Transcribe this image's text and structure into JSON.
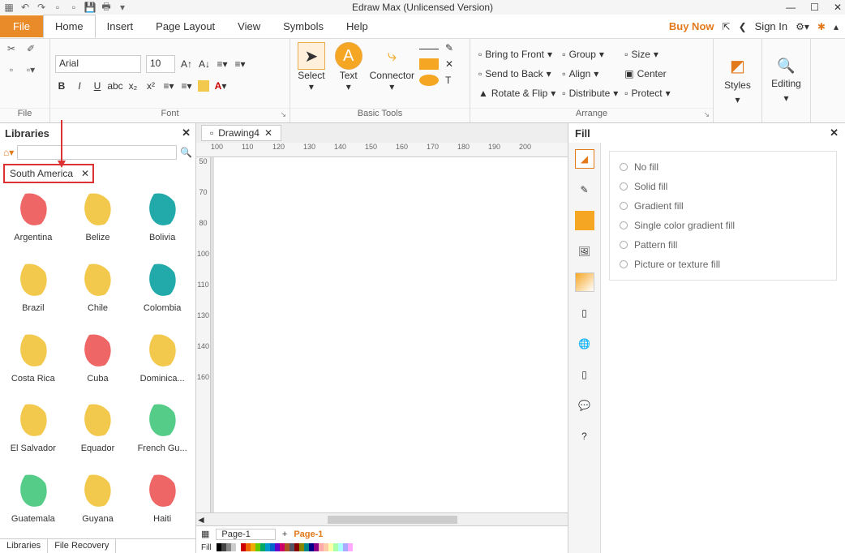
{
  "title": "Edraw Max (Unlicensed Version)",
  "menu": {
    "file": "File",
    "home": "Home",
    "insert": "Insert",
    "page_layout": "Page Layout",
    "view": "View",
    "symbols": "Symbols",
    "help": "Help"
  },
  "top_right": {
    "buy_now": "Buy Now",
    "sign_in": "Sign In"
  },
  "ribbon": {
    "file_label": "File",
    "font_label": "Font",
    "font_name": "Arial",
    "font_size": "10",
    "basic_label": "Basic Tools",
    "select": "Select",
    "text": "Text",
    "connector": "Connector",
    "arrange_label": "Arrange",
    "bring_front": "Bring to Front",
    "send_back": "Send to Back",
    "rotate_flip": "Rotate & Flip",
    "group": "Group",
    "align": "Align",
    "distribute": "Distribute",
    "size": "Size",
    "center": "Center",
    "protect": "Protect",
    "styles": "Styles",
    "editing": "Editing"
  },
  "libraries": {
    "title": "Libraries",
    "tab": "South America",
    "shapes": [
      {
        "name": "Argentina",
        "c": "#e66"
      },
      {
        "name": "Belize",
        "c": "#f2c94c"
      },
      {
        "name": "Bolivia",
        "c": "#2aa"
      },
      {
        "name": "Brazil",
        "c": "#f2c94c"
      },
      {
        "name": "Chile",
        "c": "#f2c94c"
      },
      {
        "name": "Colombia",
        "c": "#2aa"
      },
      {
        "name": "Costa Rica",
        "c": "#f2c94c"
      },
      {
        "name": "Cuba",
        "c": "#e66"
      },
      {
        "name": "Dominica...",
        "c": "#f2c94c"
      },
      {
        "name": "El Salvador",
        "c": "#f2c94c"
      },
      {
        "name": "Equador",
        "c": "#f2c94c"
      },
      {
        "name": "French Gu...",
        "c": "#5c8"
      },
      {
        "name": "Guatemala",
        "c": "#5c8"
      },
      {
        "name": "Guyana",
        "c": "#f2c94c"
      },
      {
        "name": "Haiti",
        "c": "#e66"
      }
    ]
  },
  "doc": {
    "tab": "Drawing4",
    "page_sel": "Page-1",
    "page1": "Page-1",
    "fill_label": "Fill"
  },
  "ruler_h": [
    "100",
    "110",
    "120",
    "130",
    "140",
    "150",
    "160",
    "170",
    "180",
    "190",
    "200"
  ],
  "ruler_v": [
    "50",
    "70",
    "80",
    "100",
    "110",
    "130",
    "140",
    "160"
  ],
  "fill": {
    "title": "Fill",
    "opts": [
      "No fill",
      "Solid fill",
      "Gradient fill",
      "Single color gradient fill",
      "Pattern fill",
      "Picture or texture fill"
    ]
  },
  "bottom": {
    "libraries": "Libraries",
    "file_recovery": "File Recovery"
  }
}
